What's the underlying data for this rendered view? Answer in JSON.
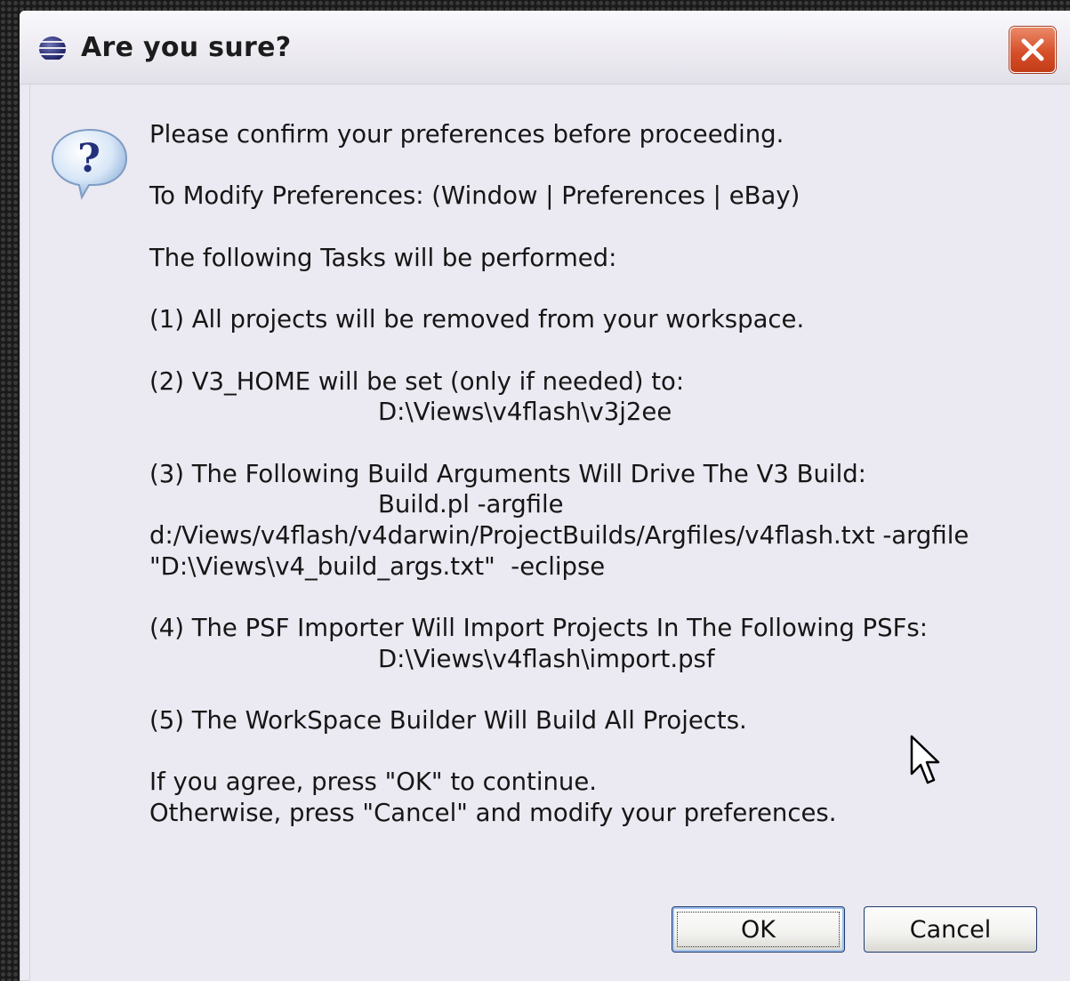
{
  "dialog": {
    "title": "Are you sure?",
    "icons": {
      "app": "eclipse-icon",
      "close": "close-icon",
      "message": "question-icon"
    },
    "message_lines": [
      "Please confirm your preferences before proceeding.",
      "",
      "To Modify Preferences: (Window | Preferences | eBay)",
      "",
      "The following Tasks will be performed:",
      "",
      "(1) All projects will be removed from your workspace.",
      "",
      "(2) V3_HOME will be set (only if needed) to:",
      "D:\\Views\\v4flash\\v3j2ee",
      "",
      "(3) The Following Build Arguments Will Drive The V3 Build:",
      "Build.pl -argfile",
      "d:/Views/v4flash/v4darwin/ProjectBuilds/Argfiles/v4flash.txt -argfile",
      "\"D:\\Views\\v4_build_args.txt\"  -eclipse",
      "",
      "(4) The PSF Importer Will Import Projects In The Following PSFs:",
      "D:\\Views\\v4flash\\import.psf",
      "",
      "(5) The WorkSpace Builder Will Build All Projects.",
      "",
      "If you agree, press \"OK\" to continue.",
      "Otherwise, press \"Cancel\" and modify your preferences."
    ],
    "buttons": {
      "ok": "OK",
      "cancel": "Cancel"
    }
  },
  "colors": {
    "dialog_background": "#ebe9f1",
    "close_button": "#d6502a",
    "button_focus": "#9ec0ec"
  }
}
